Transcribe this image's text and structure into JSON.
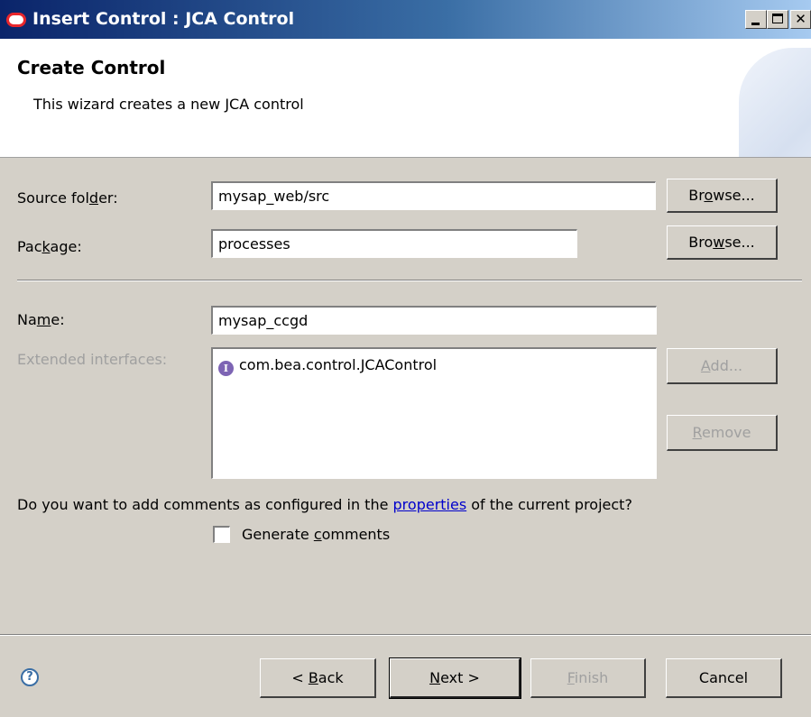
{
  "window": {
    "title": "Insert Control : JCA Control",
    "logo_icon": "oracle-logo-icon",
    "close_glyph": "✕"
  },
  "header": {
    "title": "Create Control",
    "description": "This wizard creates a new JCA control"
  },
  "form": {
    "source_folder": {
      "label_pre": "Source fol",
      "label_mnemonic": "d",
      "label_post": "er:",
      "value": "mysap_web/src",
      "browse_pre": "Br",
      "browse_mnemonic": "o",
      "browse_post": "wse..."
    },
    "package": {
      "label_pre": "Pac",
      "label_mnemonic": "k",
      "label_post": "age:",
      "value": "processes",
      "browse_pre": "Bro",
      "browse_mnemonic": "w",
      "browse_post": "se..."
    },
    "name": {
      "label_pre": "Na",
      "label_mnemonic": "m",
      "label_post": "e:",
      "value": "mysap_ccgd"
    },
    "extended_interfaces": {
      "label": "Extended interfaces:",
      "items": [
        "com.bea.control.JCAControl"
      ],
      "item_icon": "interface-icon",
      "add_mnemonic": "A",
      "add_post": "dd...",
      "remove_mnemonic": "R",
      "remove_post": "emove"
    }
  },
  "comments": {
    "question_pre": "Do you want to add comments as configured in the ",
    "link": "properties",
    "question_post": " of the current project?",
    "checkbox_pre": "Generate ",
    "checkbox_mnemonic": "c",
    "checkbox_post": "omments",
    "checked": false
  },
  "footer": {
    "help_icon": "help-icon",
    "help_glyph": "?",
    "back_pre": "< ",
    "back_mnemonic": "B",
    "back_post": "ack",
    "next_mnemonic": "N",
    "next_post": "ext >",
    "finish_mnemonic": "F",
    "finish_post": "inish",
    "cancel": "Cancel"
  }
}
